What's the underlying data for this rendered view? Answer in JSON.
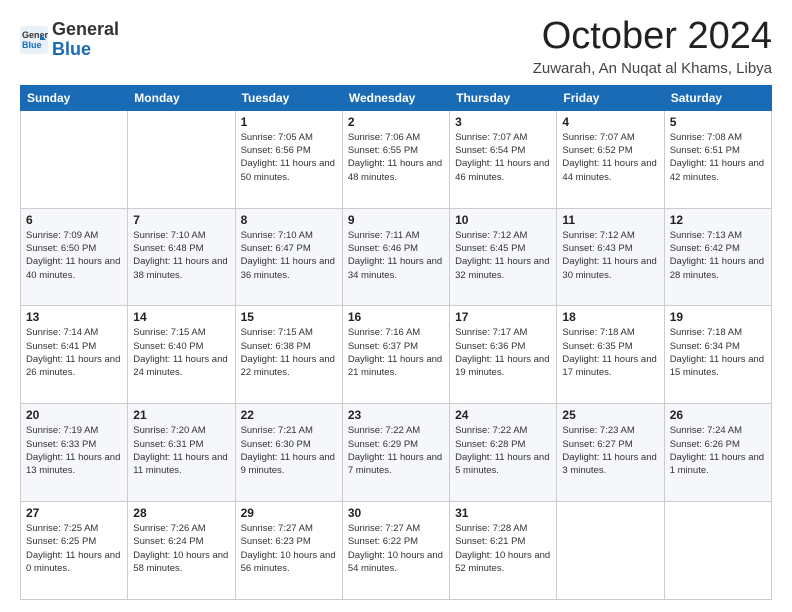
{
  "logo": {
    "line1": "General",
    "line2": "Blue"
  },
  "title": "October 2024",
  "location": "Zuwarah, An Nuqat al Khams, Libya",
  "days_of_week": [
    "Sunday",
    "Monday",
    "Tuesday",
    "Wednesday",
    "Thursday",
    "Friday",
    "Saturday"
  ],
  "weeks": [
    [
      {
        "day": "",
        "sunrise": "",
        "sunset": "",
        "daylight": ""
      },
      {
        "day": "",
        "sunrise": "",
        "sunset": "",
        "daylight": ""
      },
      {
        "day": "1",
        "sunrise": "Sunrise: 7:05 AM",
        "sunset": "Sunset: 6:56 PM",
        "daylight": "Daylight: 11 hours and 50 minutes."
      },
      {
        "day": "2",
        "sunrise": "Sunrise: 7:06 AM",
        "sunset": "Sunset: 6:55 PM",
        "daylight": "Daylight: 11 hours and 48 minutes."
      },
      {
        "day": "3",
        "sunrise": "Sunrise: 7:07 AM",
        "sunset": "Sunset: 6:54 PM",
        "daylight": "Daylight: 11 hours and 46 minutes."
      },
      {
        "day": "4",
        "sunrise": "Sunrise: 7:07 AM",
        "sunset": "Sunset: 6:52 PM",
        "daylight": "Daylight: 11 hours and 44 minutes."
      },
      {
        "day": "5",
        "sunrise": "Sunrise: 7:08 AM",
        "sunset": "Sunset: 6:51 PM",
        "daylight": "Daylight: 11 hours and 42 minutes."
      }
    ],
    [
      {
        "day": "6",
        "sunrise": "Sunrise: 7:09 AM",
        "sunset": "Sunset: 6:50 PM",
        "daylight": "Daylight: 11 hours and 40 minutes."
      },
      {
        "day": "7",
        "sunrise": "Sunrise: 7:10 AM",
        "sunset": "Sunset: 6:48 PM",
        "daylight": "Daylight: 11 hours and 38 minutes."
      },
      {
        "day": "8",
        "sunrise": "Sunrise: 7:10 AM",
        "sunset": "Sunset: 6:47 PM",
        "daylight": "Daylight: 11 hours and 36 minutes."
      },
      {
        "day": "9",
        "sunrise": "Sunrise: 7:11 AM",
        "sunset": "Sunset: 6:46 PM",
        "daylight": "Daylight: 11 hours and 34 minutes."
      },
      {
        "day": "10",
        "sunrise": "Sunrise: 7:12 AM",
        "sunset": "Sunset: 6:45 PM",
        "daylight": "Daylight: 11 hours and 32 minutes."
      },
      {
        "day": "11",
        "sunrise": "Sunrise: 7:12 AM",
        "sunset": "Sunset: 6:43 PM",
        "daylight": "Daylight: 11 hours and 30 minutes."
      },
      {
        "day": "12",
        "sunrise": "Sunrise: 7:13 AM",
        "sunset": "Sunset: 6:42 PM",
        "daylight": "Daylight: 11 hours and 28 minutes."
      }
    ],
    [
      {
        "day": "13",
        "sunrise": "Sunrise: 7:14 AM",
        "sunset": "Sunset: 6:41 PM",
        "daylight": "Daylight: 11 hours and 26 minutes."
      },
      {
        "day": "14",
        "sunrise": "Sunrise: 7:15 AM",
        "sunset": "Sunset: 6:40 PM",
        "daylight": "Daylight: 11 hours and 24 minutes."
      },
      {
        "day": "15",
        "sunrise": "Sunrise: 7:15 AM",
        "sunset": "Sunset: 6:38 PM",
        "daylight": "Daylight: 11 hours and 22 minutes."
      },
      {
        "day": "16",
        "sunrise": "Sunrise: 7:16 AM",
        "sunset": "Sunset: 6:37 PM",
        "daylight": "Daylight: 11 hours and 21 minutes."
      },
      {
        "day": "17",
        "sunrise": "Sunrise: 7:17 AM",
        "sunset": "Sunset: 6:36 PM",
        "daylight": "Daylight: 11 hours and 19 minutes."
      },
      {
        "day": "18",
        "sunrise": "Sunrise: 7:18 AM",
        "sunset": "Sunset: 6:35 PM",
        "daylight": "Daylight: 11 hours and 17 minutes."
      },
      {
        "day": "19",
        "sunrise": "Sunrise: 7:18 AM",
        "sunset": "Sunset: 6:34 PM",
        "daylight": "Daylight: 11 hours and 15 minutes."
      }
    ],
    [
      {
        "day": "20",
        "sunrise": "Sunrise: 7:19 AM",
        "sunset": "Sunset: 6:33 PM",
        "daylight": "Daylight: 11 hours and 13 minutes."
      },
      {
        "day": "21",
        "sunrise": "Sunrise: 7:20 AM",
        "sunset": "Sunset: 6:31 PM",
        "daylight": "Daylight: 11 hours and 11 minutes."
      },
      {
        "day": "22",
        "sunrise": "Sunrise: 7:21 AM",
        "sunset": "Sunset: 6:30 PM",
        "daylight": "Daylight: 11 hours and 9 minutes."
      },
      {
        "day": "23",
        "sunrise": "Sunrise: 7:22 AM",
        "sunset": "Sunset: 6:29 PM",
        "daylight": "Daylight: 11 hours and 7 minutes."
      },
      {
        "day": "24",
        "sunrise": "Sunrise: 7:22 AM",
        "sunset": "Sunset: 6:28 PM",
        "daylight": "Daylight: 11 hours and 5 minutes."
      },
      {
        "day": "25",
        "sunrise": "Sunrise: 7:23 AM",
        "sunset": "Sunset: 6:27 PM",
        "daylight": "Daylight: 11 hours and 3 minutes."
      },
      {
        "day": "26",
        "sunrise": "Sunrise: 7:24 AM",
        "sunset": "Sunset: 6:26 PM",
        "daylight": "Daylight: 11 hours and 1 minute."
      }
    ],
    [
      {
        "day": "27",
        "sunrise": "Sunrise: 7:25 AM",
        "sunset": "Sunset: 6:25 PM",
        "daylight": "Daylight: 11 hours and 0 minutes."
      },
      {
        "day": "28",
        "sunrise": "Sunrise: 7:26 AM",
        "sunset": "Sunset: 6:24 PM",
        "daylight": "Daylight: 10 hours and 58 minutes."
      },
      {
        "day": "29",
        "sunrise": "Sunrise: 7:27 AM",
        "sunset": "Sunset: 6:23 PM",
        "daylight": "Daylight: 10 hours and 56 minutes."
      },
      {
        "day": "30",
        "sunrise": "Sunrise: 7:27 AM",
        "sunset": "Sunset: 6:22 PM",
        "daylight": "Daylight: 10 hours and 54 minutes."
      },
      {
        "day": "31",
        "sunrise": "Sunrise: 7:28 AM",
        "sunset": "Sunset: 6:21 PM",
        "daylight": "Daylight: 10 hours and 52 minutes."
      },
      {
        "day": "",
        "sunrise": "",
        "sunset": "",
        "daylight": ""
      },
      {
        "day": "",
        "sunrise": "",
        "sunset": "",
        "daylight": ""
      }
    ]
  ]
}
